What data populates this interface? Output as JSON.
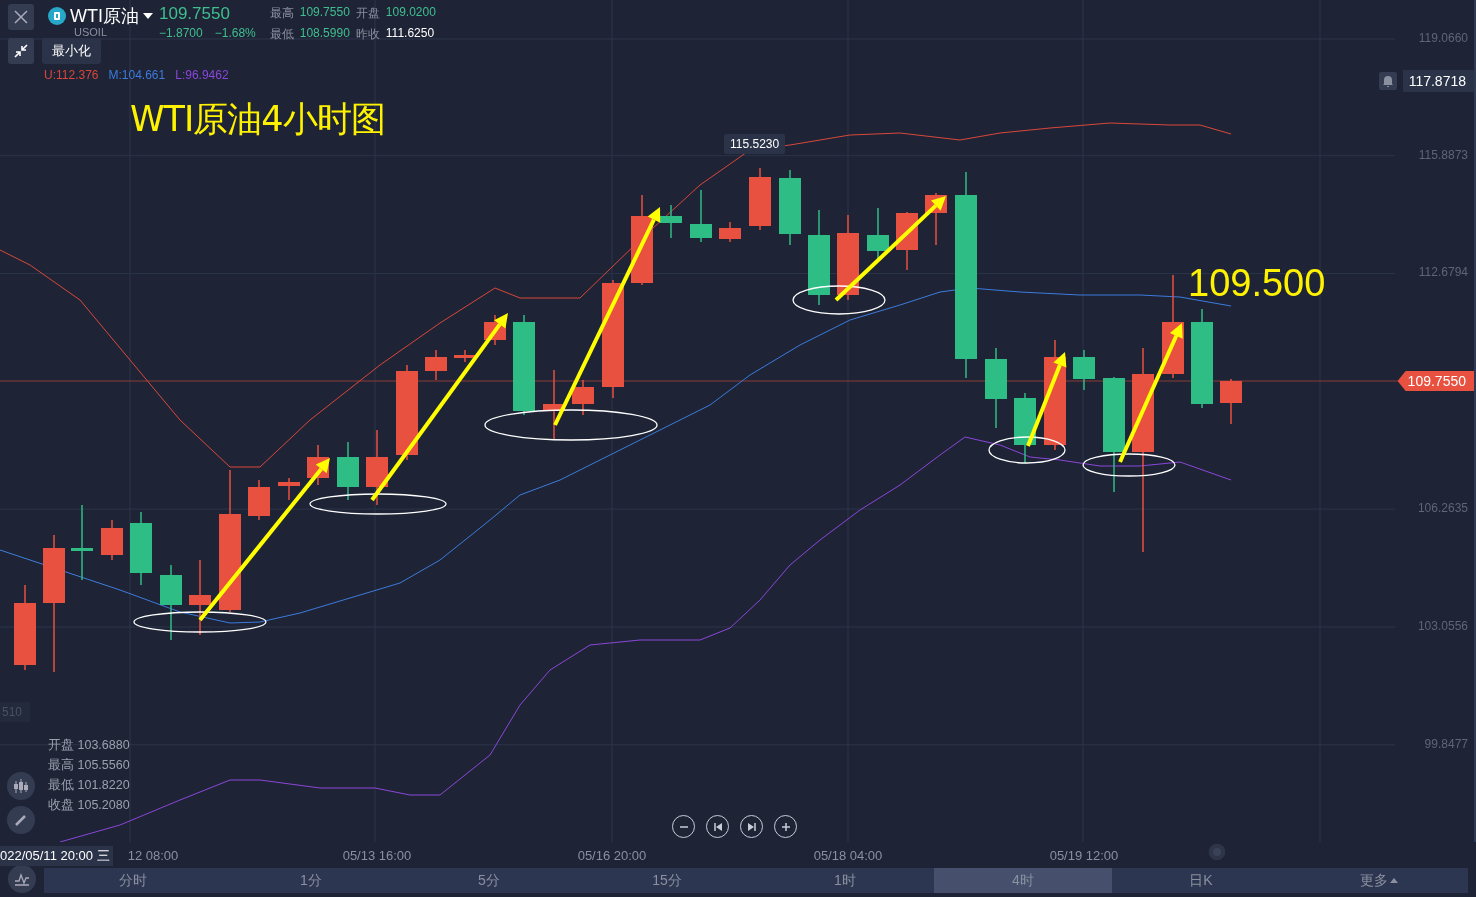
{
  "header": {
    "symbol": "WTI原油",
    "code": "USOIL",
    "price": "109.7550",
    "change": "−1.8700",
    "change_pct": "−1.68%",
    "stats": [
      {
        "label": "最高",
        "value": "109.7550",
        "color": "#3fbf8f"
      },
      {
        "label": "开盘",
        "value": "109.0200",
        "color": "#3fbf8f"
      },
      {
        "label": "最低",
        "value": "108.5990",
        "color": "#3fbf8f"
      },
      {
        "label": "昨收",
        "value": "111.6250",
        "color": "#ffffff"
      }
    ]
  },
  "tooltip": "最小化",
  "bands": [
    {
      "label": "U:112.376",
      "color": "#d9473a"
    },
    {
      "label": "M:104.661",
      "color": "#3d7bdc"
    },
    {
      "label": "L:96.9462",
      "color": "#8a46d8"
    }
  ],
  "chart_title": "WTI原油4小时图",
  "annotation": "109.500",
  "candle_label": "115.5230",
  "price_axis": [
    "119.0660",
    "115.8873",
    "112.6794",
    "106.2635",
    "103.0556",
    "99.8477"
  ],
  "crosshair_price": "117.8718",
  "current_price": "109.7550",
  "left_axis_label": "510",
  "ohlc": [
    {
      "label": "开盘",
      "value": "103.6880"
    },
    {
      "label": "最高",
      "value": "105.5560"
    },
    {
      "label": "最低",
      "value": "101.8220"
    },
    {
      "label": "收盘",
      "value": "105.2080"
    }
  ],
  "crosshair_time": "022/05/11 20:00 三",
  "time_axis": [
    "12 08:00",
    "05/13 16:00",
    "05/16 20:00",
    "05/18 04:00",
    "05/19 12:00"
  ],
  "tabs": [
    {
      "label": "分时",
      "selected": false
    },
    {
      "label": "1分",
      "selected": false
    },
    {
      "label": "5分",
      "selected": false
    },
    {
      "label": "15分",
      "selected": false
    },
    {
      "label": "1时",
      "selected": false
    },
    {
      "label": "4时",
      "selected": true
    },
    {
      "label": "日K",
      "selected": false
    },
    {
      "label": "更多",
      "selected": false,
      "kind": "menu"
    }
  ]
}
